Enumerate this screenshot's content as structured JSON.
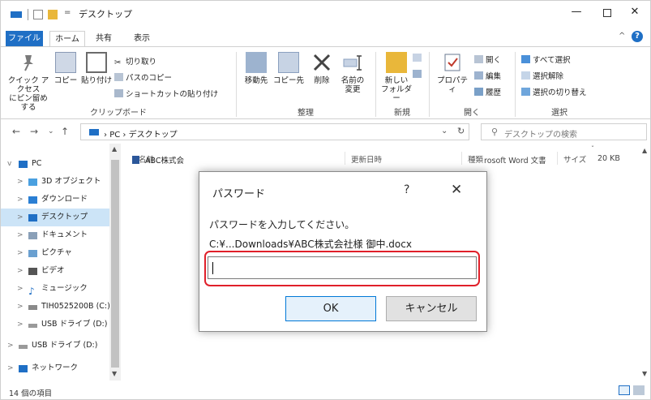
{
  "window": {
    "title": "デスクトップ",
    "quick_access_overflow": "=",
    "min_glyph": "—",
    "close_glyph": "✕"
  },
  "ribbon": {
    "tabs": [
      "ファイル",
      "ホーム",
      "共有",
      "表示"
    ],
    "collapse_glyph": "^",
    "help_glyph": "?",
    "clipboard": {
      "label": "クリップボード",
      "pin_label_1": "クイック アクセス",
      "pin_label_2": "にピン留めする",
      "copy_label": "コピー",
      "paste_label": "貼り付け",
      "cut_label": "切り取り",
      "copy_path_label": "パスのコピー",
      "paste_shortcut_label": "ショートカットの貼り付け"
    },
    "organize": {
      "label": "整理",
      "move_to_label": "移動先",
      "copy_to_label": "コピー先",
      "delete_label": "削除",
      "rename_label_1": "名前の",
      "rename_label_2": "変更"
    },
    "new": {
      "label": "新規",
      "new_folder_label_1": "新しい",
      "new_folder_label_2": "フォルダー"
    },
    "open": {
      "label": "開く",
      "properties_label": "プロパティ",
      "open_label": "開く",
      "edit_label": "編集",
      "history_label": "履歴"
    },
    "select": {
      "label": "選択",
      "select_all_label": "すべて選択",
      "select_none_label": "選択解除",
      "invert_label": "選択の切り替え"
    }
  },
  "address": {
    "path_root": "PC",
    "path_current": "デスクトップ",
    "separator": "›",
    "search_placeholder": "デスクトップの検索"
  },
  "nav": {
    "items": [
      {
        "label": "PC",
        "arrow": "v",
        "color": "#1f6fc5"
      },
      {
        "label": "3D オブジェクト",
        "arrow": ">",
        "color": "#4aa0e0"
      },
      {
        "label": "ダウンロード",
        "arrow": ">",
        "color": "#2a7fd4"
      },
      {
        "label": "デスクトップ",
        "arrow": ">",
        "color": "#1f6fc5"
      },
      {
        "label": "ドキュメント",
        "arrow": ">",
        "color": "#8aa0b8"
      },
      {
        "label": "ピクチャ",
        "arrow": ">",
        "color": "#6aa0d0"
      },
      {
        "label": "ビデオ",
        "arrow": ">",
        "color": "#555555"
      },
      {
        "label": "ミュージック",
        "arrow": ">",
        "color": "#1f6fc5"
      },
      {
        "label": "TIH0525200B (C:)",
        "arrow": ">",
        "color": "#8a8a8a"
      },
      {
        "label": "USB ドライブ (D:)",
        "arrow": ">",
        "color": "#9a9a9a"
      },
      {
        "label": "USB ドライブ (D:)",
        "arrow": ">",
        "color": "#9a9a9a"
      },
      {
        "label": "ネットワーク",
        "arrow": ">",
        "color": "#1f6fc5"
      }
    ]
  },
  "filelist": {
    "columns": [
      "名前",
      "更新日時",
      "種類",
      "サイズ"
    ],
    "files": [
      {
        "name": "ABC株式会",
        "type": "rosoft Word 文書",
        "size": "20 KB"
      }
    ]
  },
  "status": {
    "item_count": "14 個の項目"
  },
  "dialog": {
    "title": "パスワード",
    "help_glyph": "?",
    "close_glyph": "✕",
    "prompt": "パスワードを入力してください。",
    "path": "C:¥...Downloads¥ABC株式会社様 御中.docx",
    "input_value": "",
    "ok_label": "OK",
    "cancel_label": "キャンセル"
  },
  "colors": {
    "accent": "#1f6fc5",
    "highlight": "#e0202a",
    "selected_bg": "#cce4f7"
  }
}
